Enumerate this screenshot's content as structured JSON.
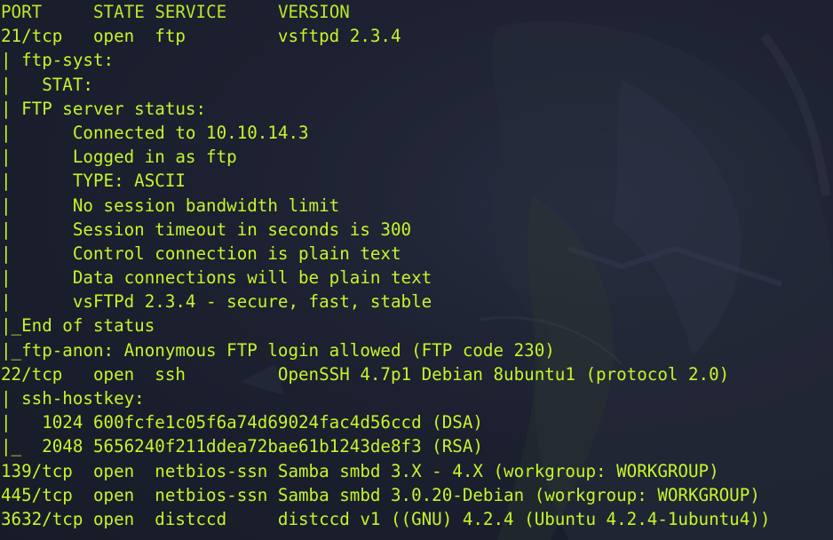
{
  "terminal": {
    "text_color": "#c5f52a",
    "background_color": "#1c2030"
  },
  "header": {
    "port": "PORT",
    "state": "STATE",
    "service": "SERVICE",
    "version": "VERSION"
  },
  "lines": [
    "21/tcp   open  ftp         vsftpd 2.3.4",
    "| ftp-syst:",
    "|   STAT:",
    "| FTP server status:",
    "|      Connected to 10.10.14.3",
    "|      Logged in as ftp",
    "|      TYPE: ASCII",
    "|      No session bandwidth limit",
    "|      Session timeout in seconds is 300",
    "|      Control connection is plain text",
    "|      Data connections will be plain text",
    "|      vsFTPd 2.3.4 - secure, fast, stable",
    "|_End of status",
    "|_ftp-anon: Anonymous FTP login allowed (FTP code 230)",
    "22/tcp   open  ssh         OpenSSH 4.7p1 Debian 8ubuntu1 (protocol 2.0)",
    "| ssh-hostkey:",
    "|   1024 600fcfe1c05f6a74d69024fac4d56ccd (DSA)",
    "|_  2048 5656240f211ddea72bae61b1243de8f3 (RSA)",
    "139/tcp  open  netbios-ssn Samba smbd 3.X - 4.X (workgroup: WORKGROUP)",
    "445/tcp  open  netbios-ssn Samba smbd 3.0.20-Debian (workgroup: WORKGROUP)",
    "3632/tcp open  distccd     distccd v1 ((GNU) 4.2.4 (Ubuntu 4.2.4-1ubuntu4))"
  ]
}
